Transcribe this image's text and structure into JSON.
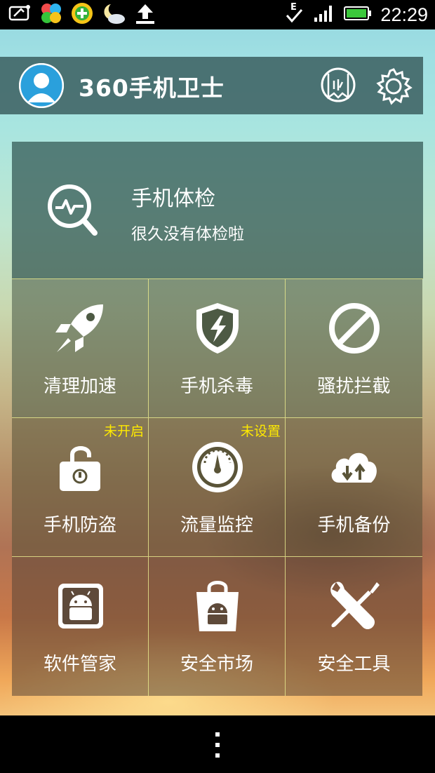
{
  "status_bar": {
    "time": "22:29",
    "network_type": "E",
    "left_icons": [
      "screen-capture-icon",
      "clover-app-icon",
      "add-app-icon",
      "weather-icon",
      "upload-icon"
    ],
    "right_icons": [
      "network-e-icon",
      "signal-icon",
      "battery-icon"
    ]
  },
  "header": {
    "title": "360手机卫士",
    "avatar": "avatar-icon",
    "buttons": [
      "badge-icon",
      "settings-gear-icon"
    ]
  },
  "checkup": {
    "title": "手机体检",
    "subtitle": "很久没有体检啦"
  },
  "tiles": [
    {
      "label": "清理加速",
      "icon": "rocket-icon",
      "tag": ""
    },
    {
      "label": "手机杀毒",
      "icon": "shield-bolt-icon",
      "tag": ""
    },
    {
      "label": "骚扰拦截",
      "icon": "block-icon",
      "tag": ""
    },
    {
      "label": "手机防盗",
      "icon": "unlocked-padlock-icon",
      "tag": "未开启"
    },
    {
      "label": "流量监控",
      "icon": "gauge-icon",
      "tag": "未设置"
    },
    {
      "label": "手机备份",
      "icon": "cloud-sync-icon",
      "tag": ""
    },
    {
      "label": "软件管家",
      "icon": "android-box-icon",
      "tag": ""
    },
    {
      "label": "安全市场",
      "icon": "android-bag-icon",
      "tag": ""
    },
    {
      "label": "安全工具",
      "icon": "wrench-screwdriver-icon",
      "tag": ""
    }
  ],
  "colors": {
    "tag_text": "#ffea00",
    "grid_line": "#e6e68c",
    "status_battery": "#3cc83c"
  }
}
